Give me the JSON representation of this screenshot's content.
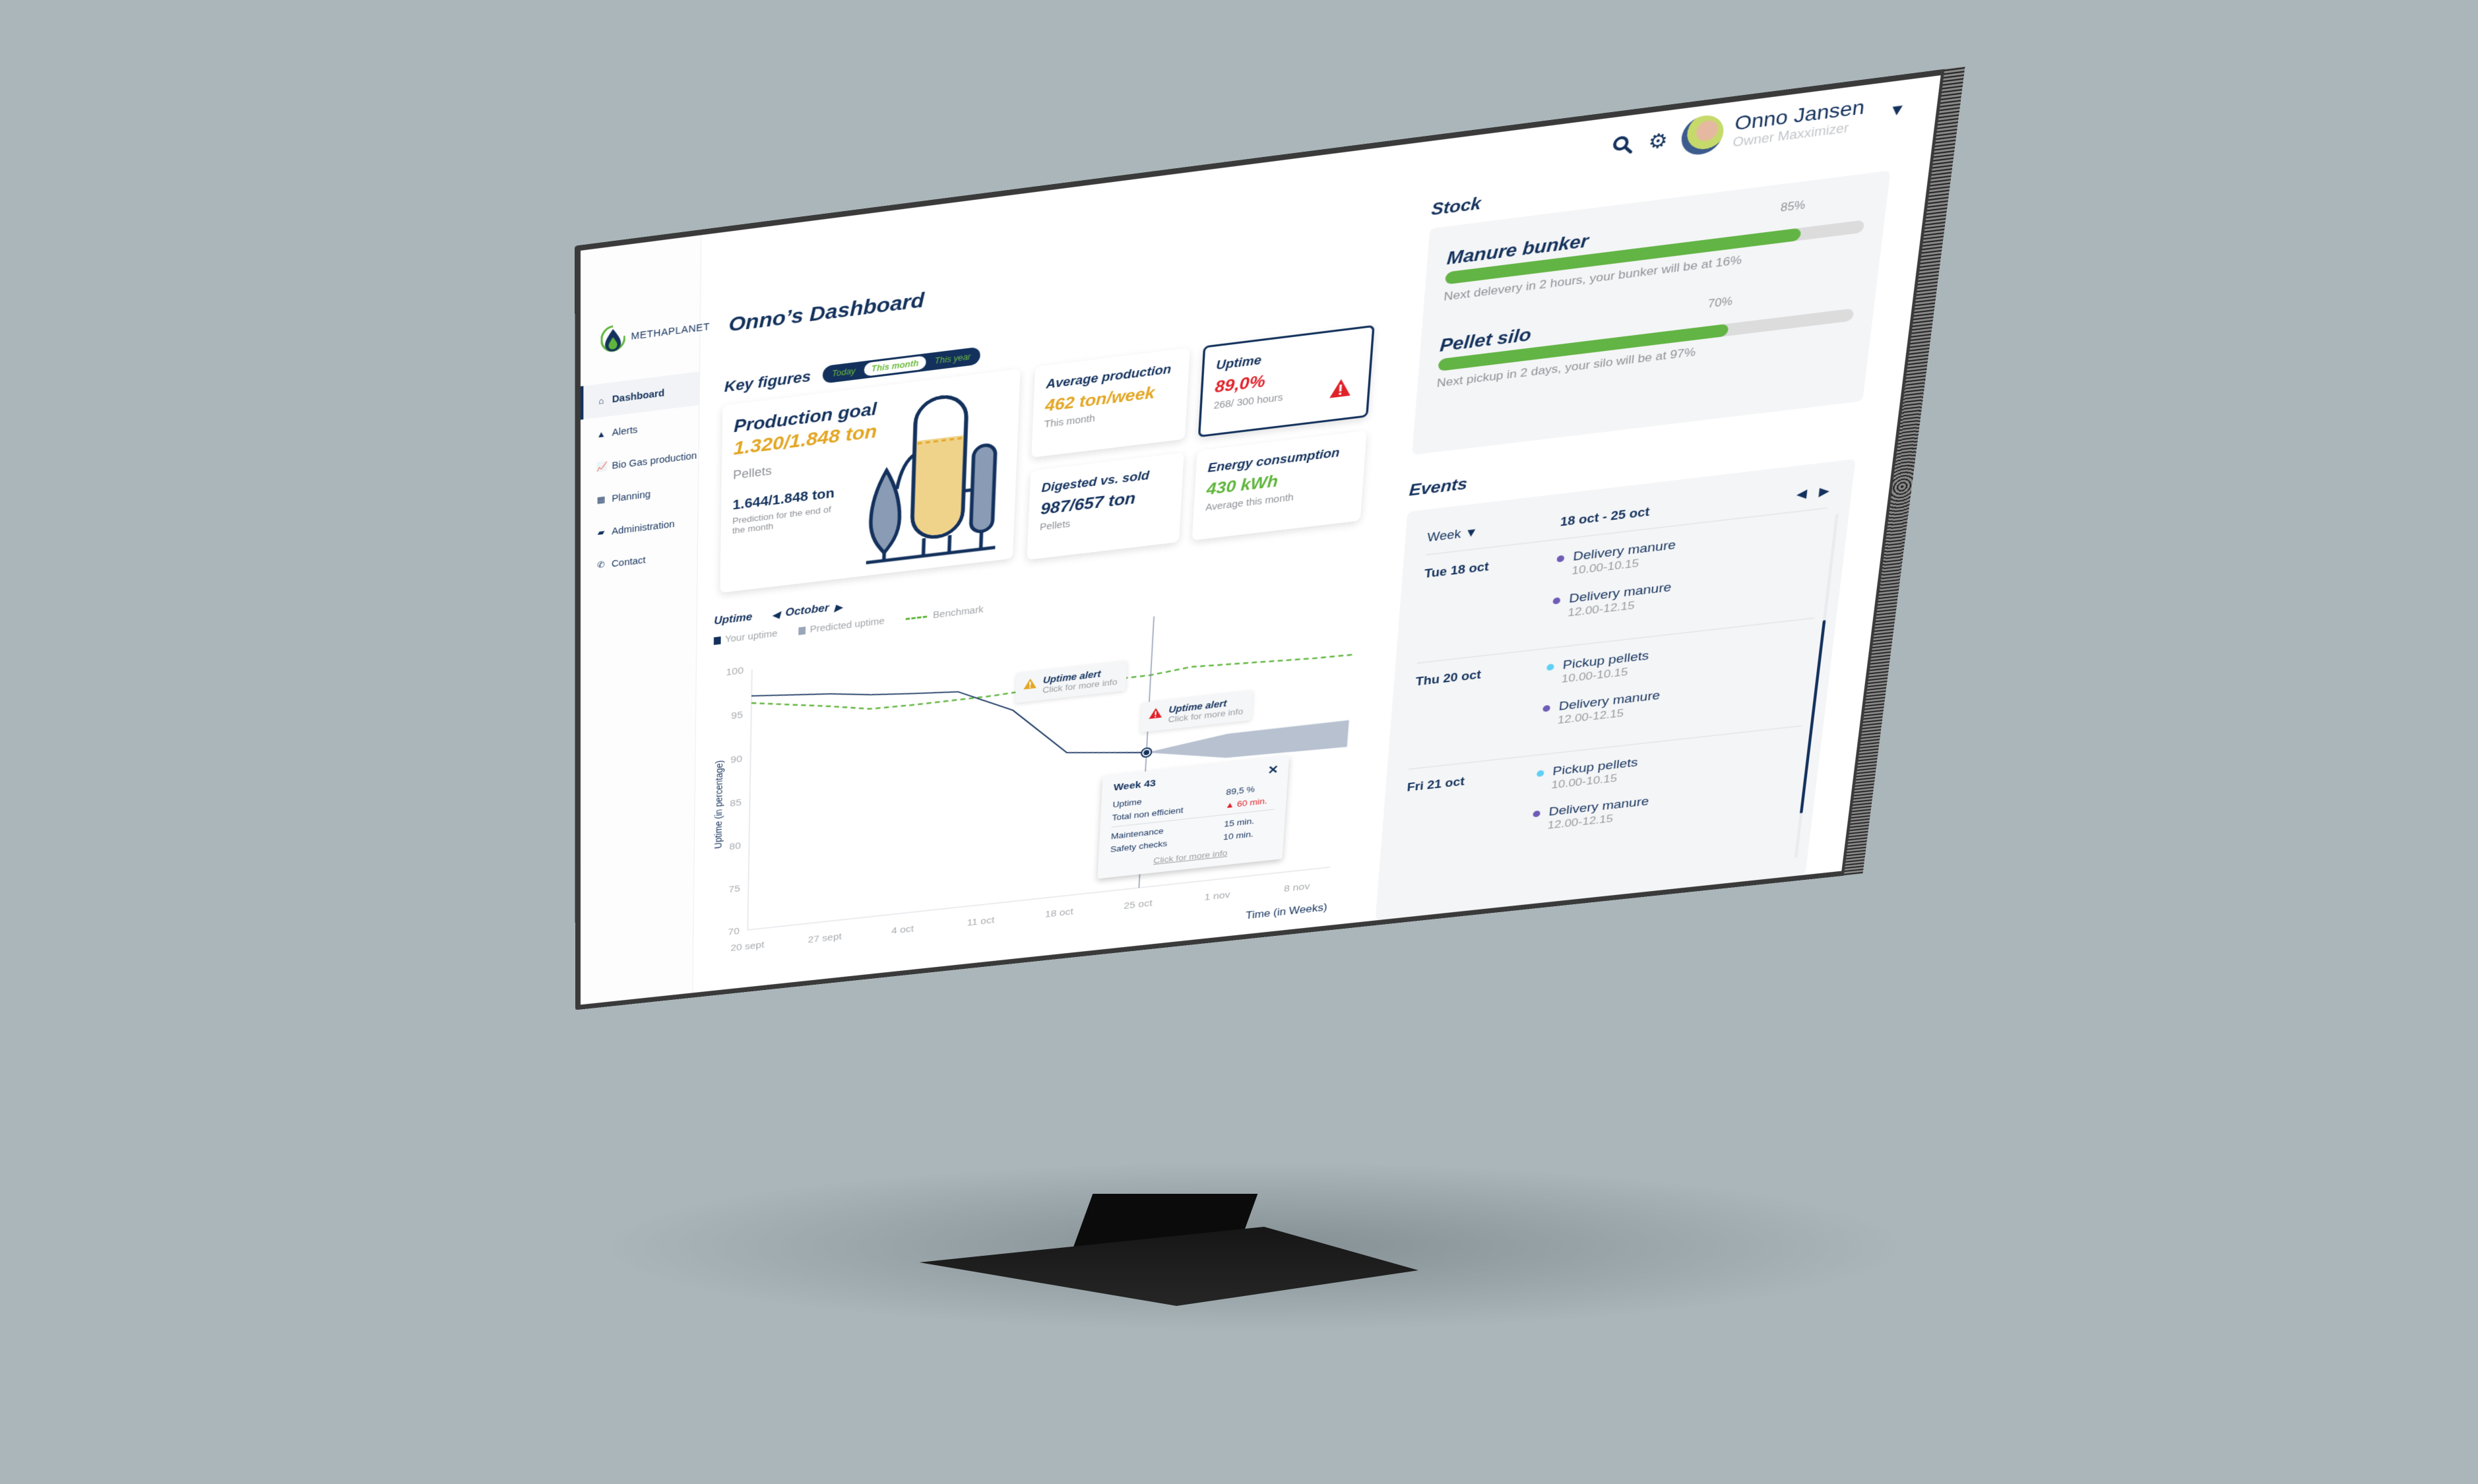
{
  "app": {
    "brand": "METHAPLANET",
    "page_title": "Onno’s Dashboard"
  },
  "colors": {
    "navy": "#13315c",
    "gold": "#e3a623",
    "red": "#e02128",
    "green": "#5fb53c",
    "bar_green": "#62b444",
    "predicted": "#b7c1d0",
    "purple": "#6e5cb6",
    "cyan": "#5fd0f4",
    "background": "#aab6ba"
  },
  "sidebar": {
    "items": [
      {
        "label": "Dashboard",
        "icon": "home-icon",
        "active": true
      },
      {
        "label": "Alerts",
        "icon": "warning-icon",
        "active": false
      },
      {
        "label": "Bio Gas production",
        "icon": "chart-line-icon",
        "active": false
      },
      {
        "label": "Planning",
        "icon": "calendar-icon",
        "active": false
      },
      {
        "label": "Administration",
        "icon": "folder-icon",
        "active": false
      },
      {
        "label": "Contact",
        "icon": "phone-icon",
        "active": false
      }
    ]
  },
  "header": {
    "search_icon": "search-icon",
    "settings_icon": "gear-icon",
    "user": {
      "name": "Onno Jansen",
      "role": "Owner Maxximizer"
    }
  },
  "key_figures": {
    "title": "Key figures",
    "periods": [
      "Today",
      "This month",
      "This year"
    ],
    "selected_period": "This month",
    "production_goal": {
      "title": "Production goal",
      "value": "1.320/1.848 ton",
      "unit_label": "Pellets",
      "prediction": "1.644/1.848 ton",
      "prediction_label": "Prediction for the end of the month",
      "fill_fraction": 0.71
    },
    "average_production": {
      "title": "Average production",
      "value": "462 ton/week",
      "sub": "This month"
    },
    "uptime": {
      "title": "Uptime",
      "value": "89,0%",
      "sub": "268/ 300 hours",
      "alert": true
    },
    "digested_vs_sold": {
      "title": "Digested vs. sold",
      "value": "987/657 ton",
      "sub": "Pellets"
    },
    "energy": {
      "title": "Energy consumption",
      "value": "430 kWh",
      "sub": "Average this month"
    }
  },
  "uptime_chart": {
    "title": "Uptime",
    "month": "October",
    "legend": [
      "Your uptime",
      "Predicted uptime",
      "Benchmark"
    ],
    "alerts": [
      {
        "title": "Uptime alert",
        "sub": "Click for more info",
        "level": "warning"
      },
      {
        "title": "Uptime alert",
        "sub": "Click for more info",
        "level": "critical"
      }
    ],
    "week_popup": {
      "title": "Week 43",
      "rows": [
        {
          "label": "Uptime",
          "value": "89,5 %"
        },
        {
          "label": "Total non efficient",
          "value": "60 min.",
          "alert": true
        },
        {
          "label": "Maintenance",
          "value": "15 min."
        },
        {
          "label": "Safety checks",
          "value": "10 min."
        }
      ],
      "link": "Click for more info"
    }
  },
  "chart_data": {
    "type": "line",
    "title": "Uptime",
    "xlabel": "Time (in Weeks)",
    "ylabel": "Uptime (in percentage)",
    "x": [
      "20 sept",
      "27 sept",
      "4 oct",
      "11 oct",
      "18 oct",
      "25 oct",
      "1 nov",
      "8 nov"
    ],
    "ylim": [
      70,
      100
    ],
    "yticks": [
      100,
      95,
      90,
      85,
      80,
      75,
      70
    ],
    "grid": false,
    "legend_position": "top-left",
    "series": [
      {
        "name": "Your uptime",
        "style": "solid",
        "x_index": [
          0,
          0.5,
          1,
          1.5,
          2,
          2.6,
          3.3,
          4,
          5
        ],
        "values": [
          97,
          96.6,
          96.2,
          95.6,
          95.2,
          94.8,
          92,
          86.5,
          85.5
        ]
      },
      {
        "name": "Benchmark",
        "style": "dashed",
        "x_index": [
          0,
          1,
          1.5,
          2,
          3,
          4,
          5,
          5.5,
          6,
          7,
          7.5
        ],
        "values": [
          96.2,
          94.8,
          94,
          93.9,
          93.9,
          94.2,
          94.2,
          94.6,
          94.4,
          94.0,
          93.9
        ]
      },
      {
        "name": "Predicted uptime",
        "style": "band",
        "x_index": [
          5,
          6,
          7,
          7.5
        ],
        "upper": [
          85.5,
          86.6,
          86.6,
          86.6
        ],
        "lower": [
          85.5,
          83.9,
          83.7,
          83.6
        ]
      }
    ],
    "annotations": [
      {
        "x_index": 3.5,
        "y": 94.0,
        "text": "Uptime alert",
        "level": "warning"
      },
      {
        "x_index": 5,
        "y": 85.5,
        "text": "Uptime alert",
        "level": "critical",
        "marker": "Week 43"
      }
    ]
  },
  "stock": {
    "title": "Stock",
    "items": [
      {
        "name": "Manure bunker",
        "percent_label": "85%",
        "percent": 85,
        "note": "Next delevery in 2 hours, your bunker will be at 16%"
      },
      {
        "name": "Pellet silo",
        "percent_label": "70%",
        "percent": 70,
        "note": "Next pickup in 2 days, your silo will be at 97%"
      }
    ]
  },
  "events": {
    "title": "Events",
    "view": "Week",
    "range": "18 oct - 25 oct",
    "days": [
      {
        "label": "Tue 18 oct",
        "items": [
          {
            "title": "Delivery manure",
            "time": "10.00-10.15",
            "type": "delivery"
          },
          {
            "title": "Delivery manure",
            "time": "12.00-12.15",
            "type": "delivery"
          }
        ]
      },
      {
        "label": "Thu 20 oct",
        "items": [
          {
            "title": "Pickup pellets",
            "time": "10.00-10.15",
            "type": "pickup"
          },
          {
            "title": "Delivery manure",
            "time": "12.00-12.15",
            "type": "delivery"
          }
        ]
      },
      {
        "label": "Fri 21 oct",
        "items": [
          {
            "title": "Pickup pellets",
            "time": "10.00-10.15",
            "type": "pickup"
          },
          {
            "title": "Delivery manure",
            "time": "12.00-12.15",
            "type": "delivery"
          }
        ]
      }
    ]
  }
}
